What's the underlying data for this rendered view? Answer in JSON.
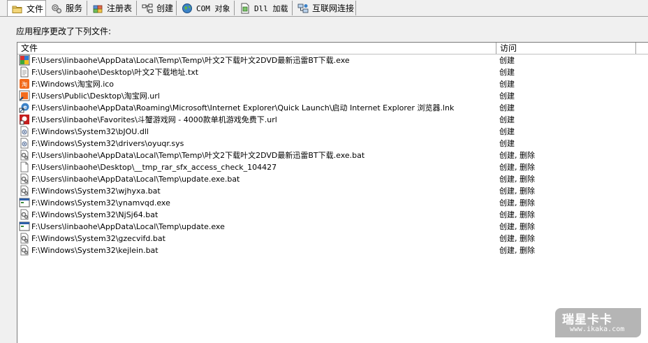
{
  "tabs": [
    {
      "label": "文件",
      "icon": "folder-icon",
      "active": true
    },
    {
      "label": "服务",
      "icon": "services-gear-icon",
      "active": false
    },
    {
      "label": "注册表",
      "icon": "registry-icon",
      "active": false
    },
    {
      "label": "创建",
      "icon": "create-nodes-icon",
      "active": false
    },
    {
      "label": "COM 对象",
      "icon": "com-globe-icon",
      "active": false
    },
    {
      "label": "Dll 加载",
      "icon": "dll-icon",
      "active": false
    },
    {
      "label": "互联网连接",
      "icon": "network-icon",
      "active": false
    }
  ],
  "caption": "应用程序更改了下列文件:",
  "columns": {
    "file": "文件",
    "access": "访问"
  },
  "rows": [
    {
      "icon": "exe-app-icon",
      "path": "F:\\Users\\linbaohe\\AppData\\Local\\Temp\\Temp\\叶文2下载叶文2DVD最新迅雷BT下载.exe",
      "access": "创建"
    },
    {
      "icon": "txt-file-icon",
      "path": "F:\\Users\\linbaohe\\Desktop\\叶文2下载地址.txt",
      "access": "创建"
    },
    {
      "icon": "taobao-ico-icon",
      "path": "F:\\Windows\\淘宝网.ico",
      "access": "创建"
    },
    {
      "icon": "url-shortcut-icon",
      "path": "F:\\Users\\Public\\Desktop\\淘宝网.url",
      "access": "创建"
    },
    {
      "icon": "ie-link-icon",
      "path": "F:\\Users\\linbaohe\\AppData\\Roaming\\Microsoft\\Internet Explorer\\Quick Launch\\启动 Internet Explorer 浏览器.lnk",
      "access": "创建"
    },
    {
      "icon": "favorites-url-icon",
      "path": "F:\\Users\\linbaohe\\Favorites\\斗蟹游戏网 - 4000款单机游戏免费下.url",
      "access": "创建"
    },
    {
      "icon": "system-file-icon",
      "path": "F:\\Windows\\System32\\bJOU.dll",
      "access": "创建"
    },
    {
      "icon": "system-file-icon",
      "path": "F:\\Windows\\System32\\drivers\\oyuqr.sys",
      "access": "创建"
    },
    {
      "icon": "bat-file-icon",
      "path": "F:\\Users\\linbaohe\\AppData\\Local\\Temp\\Temp\\叶文2下载叶文2DVD最新迅雷BT下载.exe.bat",
      "access": "创建, 删除"
    },
    {
      "icon": "blank-file-icon",
      "path": "F:\\Users\\linbaohe\\Desktop\\__tmp_rar_sfx_access_check_104427",
      "access": "创建, 删除"
    },
    {
      "icon": "bat-file-icon",
      "path": "F:\\Users\\linbaohe\\AppData\\Local\\Temp\\update.exe.bat",
      "access": "创建, 删除"
    },
    {
      "icon": "bat-file-icon",
      "path": "F:\\Windows\\System32\\wjhyxa.bat",
      "access": "创建, 删除"
    },
    {
      "icon": "exe-window-icon",
      "path": "F:\\Windows\\System32\\ynamvqd.exe",
      "access": "创建, 删除"
    },
    {
      "icon": "bat-file-icon",
      "path": "F:\\Windows\\System32\\NjSj64.bat",
      "access": "创建, 删除"
    },
    {
      "icon": "exe-window-icon",
      "path": "F:\\Users\\linbaohe\\AppData\\Local\\Temp\\update.exe",
      "access": "创建, 删除"
    },
    {
      "icon": "bat-file-icon",
      "path": "F:\\Windows\\System32\\gzecvifd.bat",
      "access": "创建, 删除"
    },
    {
      "icon": "bat-file-icon",
      "path": "F:\\Windows\\System32\\kejlein.bat",
      "access": "创建, 删除"
    }
  ],
  "watermark": {
    "title": "瑞星卡卡",
    "url": "www.ikaka.com"
  }
}
